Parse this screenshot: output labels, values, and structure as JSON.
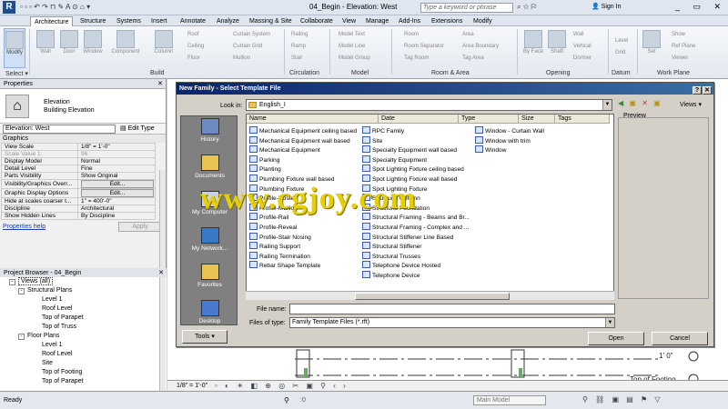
{
  "app": {
    "title": "04_Begin - Elevation: West",
    "search_placeholder": "Type a keyword or phrase",
    "signin": "Sign In",
    "logo": "R"
  },
  "tabs": [
    "Architecture",
    "Structure",
    "Systems",
    "Insert",
    "Annotate",
    "Analyze",
    "Massing & Site",
    "Collaborate",
    "View",
    "Manage",
    "Add-Ins",
    "Extensions",
    "Modify"
  ],
  "ribbon": {
    "modify": "Modify",
    "build": [
      "Wall",
      "Door",
      "Window",
      "Component",
      "Column"
    ],
    "build_small": [
      "Roof",
      "Curtain System",
      "Ceiling",
      "Curtain Grid",
      "Floor",
      "Mullion"
    ],
    "circulation": [
      "Railing",
      "Ramp",
      "Stair"
    ],
    "model": [
      "Model Text",
      "Model Line",
      "Model Group"
    ],
    "room": [
      "Room",
      "Room Separator",
      "Tag Room",
      "Area",
      "Area Boundary",
      "Tag Area"
    ],
    "opening": [
      "By Face",
      "Shaft",
      "Wall",
      "Vertical",
      "Dormer"
    ],
    "datum": [
      "Level",
      "Grid"
    ],
    "workplane": [
      "Set",
      "Show",
      "Ref Plane",
      "Viewer"
    ],
    "panels": [
      "Select",
      "Build",
      "Circulation",
      "Model",
      "Room & Area",
      "Opening",
      "Datum",
      "Work Plane"
    ]
  },
  "properties": {
    "header": "Properties",
    "type_line1": "Elevation",
    "type_line2": "Building Elevation",
    "selector": "Elevation: West",
    "edit_type": "Edit Type",
    "group": "Graphics",
    "rows": [
      {
        "k": "View Scale",
        "v": "1/8\" = 1'-0\""
      },
      {
        "k": "Scale Value    1:",
        "v": "96"
      },
      {
        "k": "Display Model",
        "v": "Normal"
      },
      {
        "k": "Detail Level",
        "v": "Fine"
      },
      {
        "k": "Parts Visibility",
        "v": "Show Original"
      },
      {
        "k": "Visibility/Graphics Overr...",
        "v": "Edit..."
      },
      {
        "k": "Graphic Display Options",
        "v": "Edit..."
      },
      {
        "k": "Hide at scales coarser t...",
        "v": "1\" = 400'-0\""
      },
      {
        "k": "Discipline",
        "v": "Architectural"
      },
      {
        "k": "Show Hidden Lines",
        "v": "By Discipline"
      }
    ],
    "help": "Properties help",
    "apply": "Apply"
  },
  "browser": {
    "header": "Project Browser - 04_Begin",
    "items": [
      "Views (all)",
      "Structural Plans",
      "Level 1",
      "Roof Level",
      "Top of Parapet",
      "Top of Truss",
      "Floor Plans",
      "Level 1",
      "Roof Level",
      "Site",
      "Top of Footing",
      "Top of Parapet"
    ]
  },
  "dialog": {
    "title": "New Family - Select Template File",
    "lookin_label": "Look in:",
    "lookin_value": "English_I",
    "views": "Views",
    "columns": [
      "Name",
      "Date",
      "Type",
      "Size",
      "Tags"
    ],
    "places": [
      "History",
      "Documents",
      "My Computer",
      "My Network...",
      "Favorites",
      "Desktop"
    ],
    "col1": [
      "Mechanical Equipment ceiling based",
      "Mechanical Equipment wall based",
      "Mechanical Equipment",
      "Parking",
      "Planting",
      "Plumbing Fixture wall based",
      "Plumbing Fixture",
      "Profile-Hosted",
      "Profile-Mullion",
      "Profile-Rail",
      "Profile-Reveal",
      "Profile-Stair Nosing",
      "Railing Support",
      "Railing Termination",
      "Rebar Shape Template"
    ],
    "col2": [
      "RPC Family",
      "Site",
      "Specialty Equipment wall based",
      "Specialty Equipment",
      "Spot Lighting Fixture ceiling based",
      "Spot Lighting Fixture wall based",
      "Spot Lighting Fixture",
      "Structural Column",
      "Structural Foundation",
      "Structural Framing - Beams and Br...",
      "Structural Framing - Complex and ...",
      "Structural Stiffener Line Based",
      "Structural Stiffener",
      "Structural Trusses",
      "Telephone Device Hosted",
      "Telephone Device"
    ],
    "col3": [
      "Window - Curtain Wall",
      "Window with trim",
      "Window"
    ],
    "preview": "Preview",
    "filename_label": "File name:",
    "filename_value": "",
    "filetype_label": "Files of type:",
    "filetype_value": "Family Template Files  (*.rft)",
    "tools": "Tools",
    "open": "Open",
    "cancel": "Cancel"
  },
  "canvas": {
    "level_label": "1'  0\"",
    "footing_label": "Top of Footing"
  },
  "viewctl": {
    "scale": "1/8\" = 1'-0\""
  },
  "status": {
    "text": "Ready",
    "model": "Main Model",
    "count": ":0"
  },
  "watermark": "www.cgjoy.com"
}
